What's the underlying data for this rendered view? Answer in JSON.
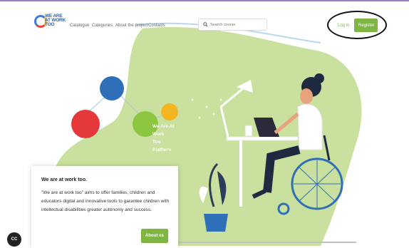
{
  "nav": {
    "logo_text": "WE ARE\nAT WORK\nTOO",
    "menu": [
      "Catalogue",
      "Categories",
      "About the project",
      "Contacts"
    ],
    "search_placeholder": "Search course",
    "login_label": "Log in",
    "register_label": "Register"
  },
  "hero": {
    "text": [
      "We Are At",
      "Work",
      "Too",
      "Platform"
    ]
  },
  "card": {
    "title": "We are at work too.",
    "body": "\"We are at work too\" aims to offer families, children and educators digital and innovative tools to garantee children with intellectual disabilities greater autonomy and success.",
    "button_label": "About us"
  },
  "cc_badge": "CC",
  "colors": {
    "accent_green": "#7fb542",
    "hero_green": "#c5dd97",
    "blob_blue": "#2f6fb8",
    "blob_red": "#e5383b",
    "blob_green": "#8cc63f",
    "blob_yellow": "#f4b521"
  }
}
